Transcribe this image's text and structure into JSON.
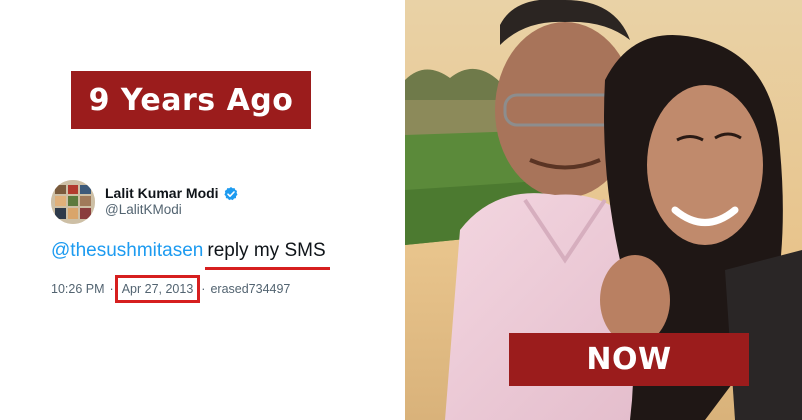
{
  "labels": {
    "then": "9 Years Ago",
    "now": "NOW"
  },
  "tweet": {
    "display_name": "Lalit Kumar Modi",
    "handle": "@LalitKModi",
    "mention": "@thesushmitasen",
    "text": "reply my SMS",
    "time": "10:26 PM",
    "separator": "·",
    "date": "Apr 27, 2013",
    "source": "erased734497"
  },
  "colors": {
    "label_bg": "#9b1c1c",
    "highlight": "#d61f1f",
    "mention": "#1d9bf0",
    "verified": "#1d9bf0"
  },
  "icons": {
    "verified": "verified-badge-icon"
  }
}
